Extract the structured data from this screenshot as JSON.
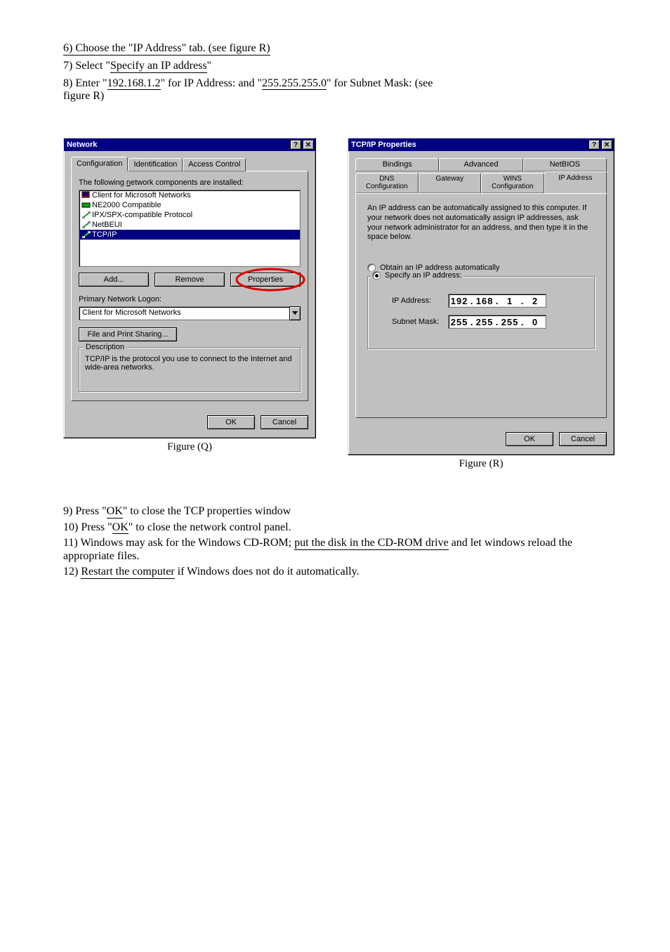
{
  "intro": {
    "line1": "6) Choose the \"IP Address\" tab. (see figure R)",
    "line2a": "7) Select \"",
    "line2_underlined": "Specify an IP address",
    "line2b": "\""
  },
  "enter": {
    "prefix_a": "8) Enter \"",
    "ip_underlined": "192.168.1.2",
    "mid": "\" for IP Address: and \"",
    "mask_underlined": "255.255.255.0",
    "suffix": "\" for Subnet Mask: (see",
    "tail": "figure R)"
  },
  "network_dialog": {
    "title": "Network",
    "tabs": [
      "Configuration",
      "Identification",
      "Access Control"
    ],
    "list_label_a": "The following ",
    "list_label_under": "n",
    "list_label_b": "etwork components are installed:",
    "items": [
      {
        "label": "Client for Microsoft Networks"
      },
      {
        "label": "NE2000 Compatible"
      },
      {
        "label": "IPX/SPX-compatible Protocol"
      },
      {
        "label": "NetBEUI"
      },
      {
        "label": "TCP/IP",
        "selected": true
      }
    ],
    "add_btn": "Add...",
    "remove_btn": "Remove",
    "properties_btn": "Properties",
    "primary_label": "Primary Network Logon:",
    "primary_value": "Client for Microsoft Networks",
    "file_print_btn": "File and Print Sharing...",
    "desc_title": "Description",
    "desc_text": "TCP/IP is the protocol you use to connect to the Internet and wide-area networks.",
    "ok": "OK",
    "cancel": "Cancel"
  },
  "tcpip_dialog": {
    "title": "TCP/IP Properties",
    "tabs_row1": [
      "Bindings",
      "Advanced",
      "NetBIOS"
    ],
    "tabs_row2": [
      "DNS Configuration",
      "Gateway",
      "WINS Configuration",
      "IP Address"
    ],
    "info_text": "An IP address can be automatically assigned to this computer. If your network does not automatically assign IP addresses, ask your network administrator for an address, and then type it in the space below.",
    "radio_auto": "Obtain an IP address automatically",
    "radio_specify": "Specify an IP address:",
    "ip_label": "IP Address:",
    "ip_value": [
      "192",
      "168",
      "1",
      "2"
    ],
    "mask_label": "Subnet Mask:",
    "mask_value": [
      "255",
      "255",
      "255",
      "0"
    ],
    "ok": "OK",
    "cancel": "Cancel"
  },
  "figQ": "Figure (Q)",
  "figR": "Figure (R)",
  "steps": {
    "s9a": "9) Press \"",
    "s9u": "OK",
    "s9b": "\" to close the TCP properties window",
    "s10a": "10) Press \"",
    "s10u": "OK",
    "s10b": "\" to close the network control panel.",
    "s11a": "11) Windows may ask for the Windows CD-ROM; ",
    "s11u": "put the disk in the CD-ROM drive",
    "s11b": " and let windows reload the appropriate files.",
    "s12a": "12) ",
    "s12u": "Restart the computer",
    "s12b": " if Windows does not do it automatically."
  }
}
